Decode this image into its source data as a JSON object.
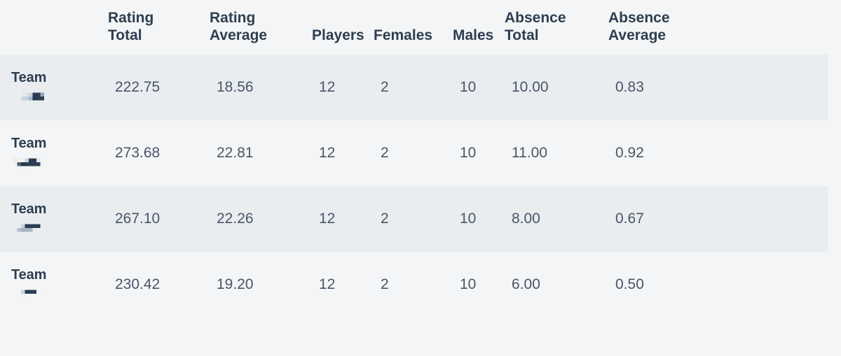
{
  "table": {
    "name": "team-statistics-table",
    "columns": [
      {
        "key": "team",
        "label": "",
        "label_line1": "",
        "label_line2": ""
      },
      {
        "key": "rating_total",
        "label": "Rating Total",
        "label_line1": "Rating",
        "label_line2": "Total"
      },
      {
        "key": "rating_average",
        "label": "Rating Average",
        "label_line1": "Rating",
        "label_line2": "Average"
      },
      {
        "key": "players",
        "label": "Players",
        "label_line1": "",
        "label_line2": "Players"
      },
      {
        "key": "females",
        "label": "Females",
        "label_line1": "",
        "label_line2": "Females"
      },
      {
        "key": "males",
        "label": "Males",
        "label_line1": "",
        "label_line2": "Males"
      },
      {
        "key": "absence_total",
        "label": "Absence Total",
        "label_line1": "Absence",
        "label_line2": "Total"
      },
      {
        "key": "absence_average",
        "label": "Absence Average",
        "label_line1": "Absence",
        "label_line2": "Average"
      }
    ],
    "rows": [
      {
        "team_label": "Team",
        "team_name_redacted": true,
        "rating_total": "222.75",
        "rating_average": "18.56",
        "players": "12",
        "females": "2",
        "males": "10",
        "absence_total": "10.00",
        "absence_average": "0.83"
      },
      {
        "team_label": "Team",
        "team_name_redacted": true,
        "rating_total": "273.68",
        "rating_average": "22.81",
        "players": "12",
        "females": "2",
        "males": "10",
        "absence_total": "11.00",
        "absence_average": "0.92"
      },
      {
        "team_label": "Team",
        "team_name_redacted": true,
        "rating_total": "267.10",
        "rating_average": "22.26",
        "players": "12",
        "females": "2",
        "males": "10",
        "absence_total": "8.00",
        "absence_average": "0.67"
      },
      {
        "team_label": "Team",
        "team_name_redacted": true,
        "rating_total": "230.42",
        "rating_average": "19.20",
        "players": "12",
        "females": "2",
        "males": "10",
        "absence_total": "6.00",
        "absence_average": "0.50"
      }
    ]
  },
  "colors": {
    "page_background": "#f4f5f6",
    "row_stripe": "#e9edf0",
    "header_text": "#2d3e50",
    "body_text": "#4a5568",
    "redaction_dark": "#2c3e50",
    "redaction_mid": "#8ea2b8",
    "redaction_light": "#c8d4de"
  }
}
